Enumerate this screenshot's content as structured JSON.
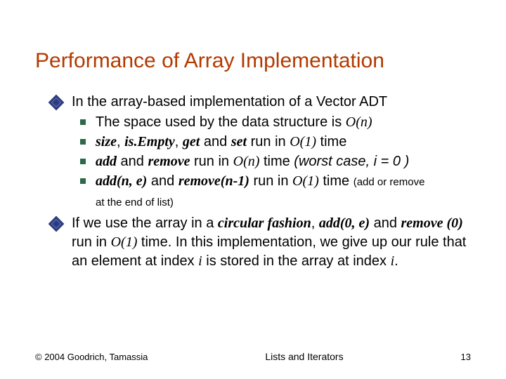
{
  "title": "Performance of Array Implementation",
  "b1_intro": "In the array-based implementation of a Vector ADT",
  "s1_a": "The space used by the data structure is ",
  "s1_b": "O(n)",
  "s2_a": "size",
  "s2_b": ", ",
  "s2_c": "is.Empty",
  "s2_d": ", ",
  "s2_e": "get",
  "s2_f": " and ",
  "s2_g": "set",
  "s2_h": " run in ",
  "s2_i": "O(1)",
  "s2_j": " time",
  "s3_a": "add",
  "s3_b": " and ",
  "s3_c": "remove",
  "s3_d": "  run in ",
  "s3_e": "O(n)",
  "s3_f": " time ",
  "s3_g": "(worst case, i = 0 )",
  "s4_a": "add(n, e)",
  "s4_b": " and ",
  "s4_c": "remove(n-1)",
  "s4_d": "  run in ",
  "s4_e": "O(1)",
  "s4_f": " time ",
  "s4_g": "(add or remove",
  "trail": "at the end of list)",
  "b2_a": "If we use the array in a ",
  "b2_b": "circular fashion",
  "b2_c": ", ",
  "b2_d": "add(0, e)",
  "b2_e": " and ",
  "b2_f": "remove (0)",
  "b2_g": " run in ",
  "b2_h": "O(1)",
  "b2_i": " time. In this implementation, we give up our rule that an element at index ",
  "b2_j": "i",
  "b2_k": " is stored in the array at index ",
  "b2_l": "i",
  "b2_m": ".",
  "footer_left": "© 2004 Goodrich, Tamassia",
  "footer_center": "Lists and Iterators",
  "footer_right": "13"
}
